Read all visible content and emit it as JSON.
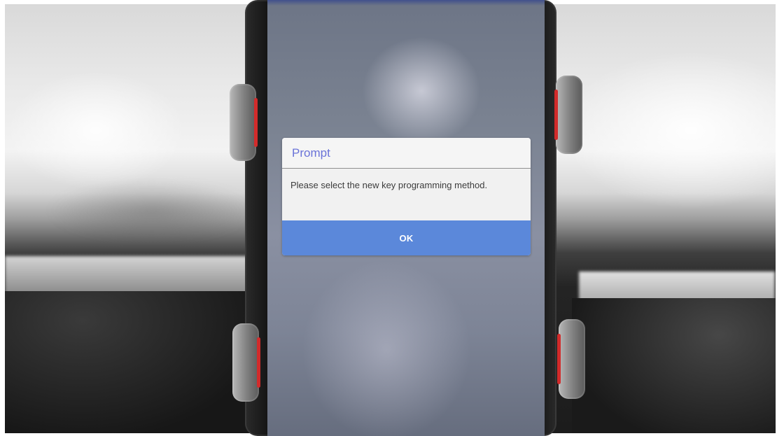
{
  "dialog": {
    "title": "Prompt",
    "message": "Please select the new key programming method.",
    "ok_label": "OK"
  },
  "colors": {
    "title_text": "#6a73d8",
    "ok_button": "#5b88da"
  }
}
